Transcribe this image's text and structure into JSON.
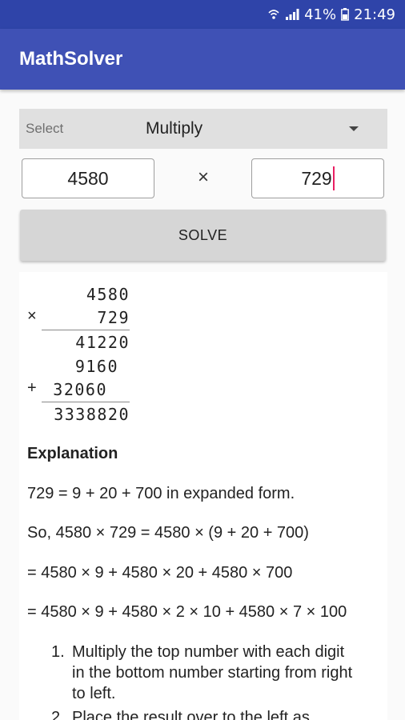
{
  "status_bar": {
    "battery": "41%",
    "time": "21:49"
  },
  "app_bar": {
    "title": "MathSolver"
  },
  "operation_select": {
    "label": "Select",
    "value": "Multiply"
  },
  "inputs": {
    "first": "4580",
    "operator": "×",
    "second": "729"
  },
  "solve_button": {
    "label": "SOLVE"
  },
  "multiplication": {
    "multiplicand": "4580",
    "multiplier_symbol": "×",
    "multiplier": "729",
    "partials": [
      "41220",
      "9160",
      "32060"
    ],
    "plus_symbol": "+",
    "result": "3338820"
  },
  "explanation": {
    "heading": "Explanation",
    "lines": [
      "729 = 9 + 20 + 700 in expanded form.",
      "So, 4580 × 729 = 4580 × (9 + 20 + 700)",
      "= 4580 × 9 + 4580 × 20 + 4580 × 700",
      "= 4580 × 9 + 4580 × 2 × 10 + 4580 × 7 × 100"
    ],
    "steps": [
      {
        "number": "1.",
        "text": "Multiply the top number with each digit in the bottom number starting from right to left."
      },
      {
        "number": "2.",
        "text": "Place the result over to the left as"
      }
    ]
  },
  "colors": {
    "status_bar": "#2f44a9",
    "app_bar": "#3f51b5",
    "caret": "#e91e63"
  }
}
